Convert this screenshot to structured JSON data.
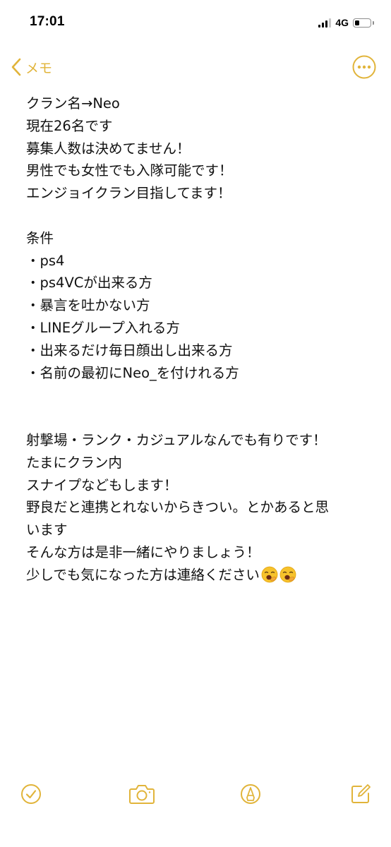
{
  "status_bar": {
    "time": "17:01",
    "network": "4G",
    "signal_bars": 3,
    "battery_level": 0.25
  },
  "nav": {
    "back_label": "メモ",
    "accent_color": "#e1b43a"
  },
  "note": {
    "lines": [
      "クラン名→Neo",
      "現在26名です",
      "募集人数は決めてません！",
      "男性でも女性でも入隊可能です！",
      "エンジョイクラン目指してます！",
      "",
      "条件",
      "・ps4",
      "・ps4VCが出来る方",
      "・暴言を吐かない方",
      "・LINEグループ入れる方",
      "・出来るだけ毎日顔出し出来る方",
      "・名前の最初にNeo_を付けれる方",
      "",
      "",
      "射撃場・ランク・カジュアルなんでも有りです！",
      "たまにクラン内",
      "スナイプなどもします！",
      "野良だと連携とれないからきつい。とかあると思",
      "います",
      "そんな方は是非一緒にやりましょう！",
      "少しでも気になった方は連絡ください"
    ],
    "trailing_emoji": [
      "yawning-face-emoji",
      "yawning-face-emoji"
    ]
  },
  "toolbar": {
    "icons": [
      "checklist-icon",
      "camera-icon",
      "markup-pen-icon",
      "compose-icon"
    ]
  }
}
